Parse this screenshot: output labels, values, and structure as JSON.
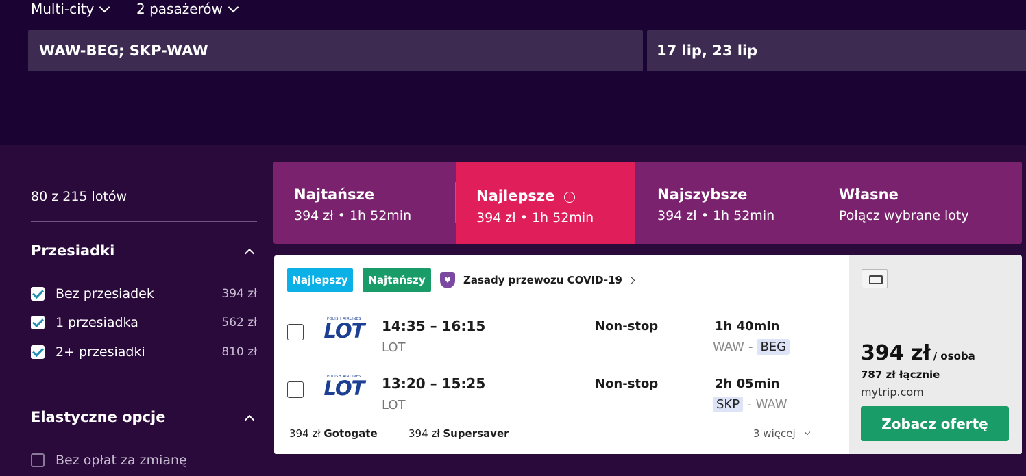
{
  "search": {
    "trip_type": "Multi-city",
    "passengers": "2 pasażerów",
    "route": "WAW-BEG; SKP-WAW",
    "dates": "17 lip, 23 lip"
  },
  "sidebar": {
    "count": "80 z 215 lotów",
    "stops_title": "Przesiadki",
    "stops": [
      {
        "label": "Bez przesiadek",
        "price": "394 zł",
        "checked": true
      },
      {
        "label": "1 przesiadka",
        "price": "562 zł",
        "checked": true
      },
      {
        "label": "2+ przesiadki",
        "price": "810 zł",
        "checked": true
      }
    ],
    "flex_title": "Elastyczne opcje",
    "flex_options": [
      {
        "label": "Bez opłat za zmianę",
        "checked": false
      }
    ]
  },
  "tabs": [
    {
      "title": "Najtańsze",
      "sub": "394 zł • 1h 52min"
    },
    {
      "title": "Najlepsze",
      "sub": "394 zł • 1h 52min",
      "active": true
    },
    {
      "title": "Najszybsze",
      "sub": "394 zł • 1h 52min"
    },
    {
      "title": "Własne",
      "sub": "Połącz wybrane loty"
    }
  ],
  "result": {
    "badges": {
      "best": "Najlepszy",
      "cheapest": "Najtańszy"
    },
    "covid": "Zasady przewozu COVID-19",
    "legs": [
      {
        "logo_small": "POLISH AIRLINES",
        "logo": "LOT",
        "times": "14:35 – 16:15",
        "carrier": "LOT",
        "stops": "Non-stop",
        "duration": "1h 40min",
        "from": "WAW",
        "dash": "-",
        "to": "BEG"
      },
      {
        "logo_small": "POLISH AIRLINES",
        "logo": "LOT",
        "times": "13:20 – 15:25",
        "carrier": "LOT",
        "stops": "Non-stop",
        "duration": "2h 05min",
        "from": "SKP",
        "dash": "-",
        "to": "WAW"
      }
    ],
    "providers": [
      {
        "price": "394 zł",
        "name": "Gotogate"
      },
      {
        "price": "394 zł",
        "name": "Supersaver"
      }
    ],
    "more": "3 więcej",
    "price": "394 zł",
    "per_person": "/ osoba",
    "total": "787 zł łącznie",
    "site": "mytrip.com",
    "cta": "Zobacz ofertę"
  },
  "colors": {
    "header_bg": "#1b0433",
    "body_bg": "#2a0a3a",
    "tabs_bg": "#7a226e",
    "active_tab": "#e01e5a",
    "badge_best": "#0ab0e6",
    "badge_cheapest": "#199c67",
    "cta": "#199c67"
  }
}
